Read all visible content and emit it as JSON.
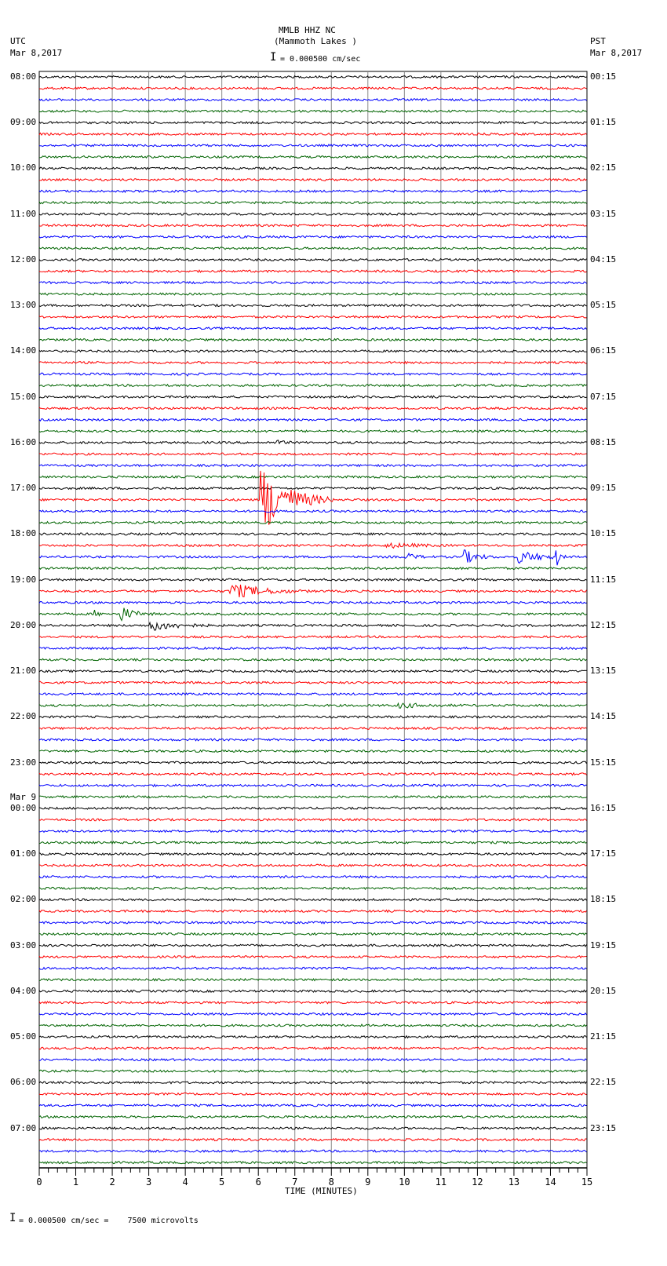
{
  "header": {
    "station": "MMLB HHZ NC",
    "location": "(Mammoth Lakes )",
    "scale": "= 0.000500 cm/sec",
    "left_tz": "UTC",
    "left_date": "Mar 8,2017",
    "right_tz": "PST",
    "right_date": "Mar 8,2017"
  },
  "footer": {
    "scale": "= 0.000500 cm/sec =    7500 microvolts"
  },
  "chart_data": {
    "type": "line",
    "title": "MMLB HHZ NC (Mammoth Lakes )",
    "xlabel": "TIME (MINUTES)",
    "xlim": [
      0,
      15
    ],
    "x_ticks": [
      "0",
      "1",
      "2",
      "3",
      "4",
      "5",
      "6",
      "7",
      "8",
      "9",
      "10",
      "11",
      "12",
      "13",
      "14",
      "15"
    ],
    "traces_per_hour": 4,
    "trace_count": 96,
    "trace_colors": [
      "#000000",
      "#ff0000",
      "#0000ff",
      "#006400"
    ],
    "left_labels": [
      "08:00",
      "09:00",
      "10:00",
      "11:00",
      "12:00",
      "13:00",
      "14:00",
      "15:00",
      "16:00",
      "17:00",
      "18:00",
      "19:00",
      "20:00",
      "21:00",
      "22:00",
      "23:00",
      "00:00",
      "01:00",
      "02:00",
      "03:00",
      "04:00",
      "05:00",
      "06:00",
      "07:00"
    ],
    "date_change_label": "Mar 9",
    "right_labels": [
      "00:15",
      "01:15",
      "02:15",
      "03:15",
      "04:15",
      "05:15",
      "06:15",
      "07:15",
      "08:15",
      "09:15",
      "10:15",
      "11:15",
      "12:15",
      "13:15",
      "14:15",
      "15:15",
      "16:15",
      "17:15",
      "18:15",
      "19:15",
      "20:15",
      "21:15",
      "22:15",
      "23:15"
    ],
    "events": [
      {
        "trace": 26,
        "minute": 4.0,
        "duration": 0.2,
        "amplitude": 5
      },
      {
        "trace": 32,
        "minute": 6.5,
        "duration": 0.8,
        "amplitude": 3
      },
      {
        "trace": 37,
        "minute": 6.05,
        "duration": 2.0,
        "amplitude": 48
      },
      {
        "trace": 41,
        "minute": 9.5,
        "duration": 3.0,
        "amplitude": 3
      },
      {
        "trace": 42,
        "minute": 10.0,
        "duration": 1.0,
        "amplitude": 5
      },
      {
        "trace": 42,
        "minute": 11.6,
        "duration": 1.0,
        "amplitude": 10
      },
      {
        "trace": 42,
        "minute": 13.1,
        "duration": 1.9,
        "amplitude": 8
      },
      {
        "trace": 42,
        "minute": 14.15,
        "duration": 0.2,
        "amplitude": 16
      },
      {
        "trace": 45,
        "minute": 5.2,
        "duration": 2.4,
        "amplitude": 11
      },
      {
        "trace": 47,
        "minute": 1.5,
        "duration": 0.3,
        "amplitude": 6
      },
      {
        "trace": 47,
        "minute": 2.2,
        "duration": 1.0,
        "amplitude": 11
      },
      {
        "trace": 48,
        "minute": 3.0,
        "duration": 2.2,
        "amplitude": 7
      },
      {
        "trace": 54,
        "minute": 7.9,
        "duration": 0.1,
        "amplitude": 6
      },
      {
        "trace": 55,
        "minute": 9.8,
        "duration": 3.0,
        "amplitude": 3
      },
      {
        "trace": 64,
        "minute": 14.3,
        "duration": 0.15,
        "amplitude": 9
      }
    ]
  }
}
